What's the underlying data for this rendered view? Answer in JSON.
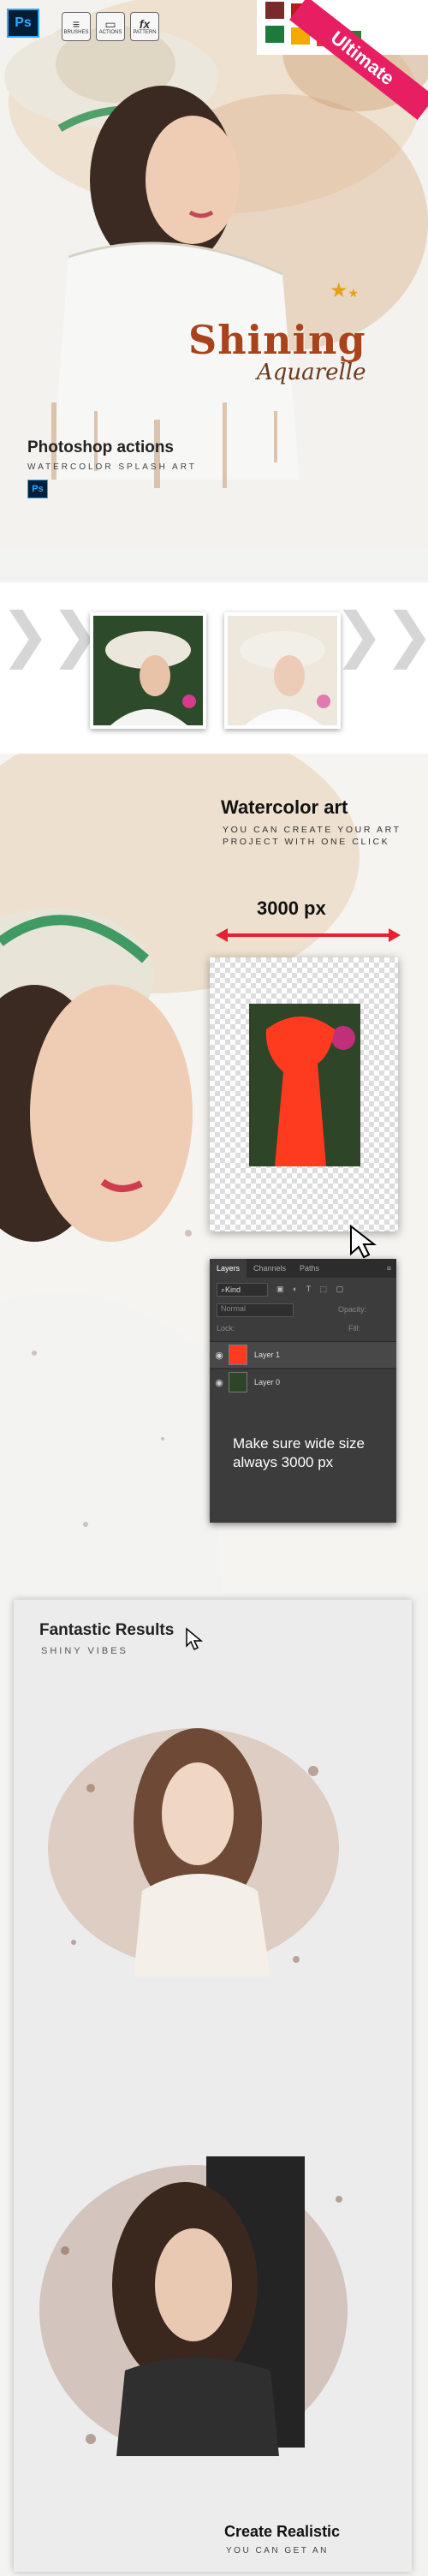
{
  "header": {
    "ps_badge": "Ps",
    "tools": [
      {
        "label": "BRUSHES",
        "glyph": "≡"
      },
      {
        "label": "ACTIONS",
        "glyph": "▭"
      },
      {
        "label": "PATTERN",
        "glyph": "fx"
      }
    ],
    "ribbon": "Ultimate"
  },
  "hero": {
    "title": "Shining",
    "subtitle": "Aquarelle",
    "heading": "Photoshop actions",
    "tagline": "WATERCOLOR SPLASH ART",
    "ps_small": "Ps"
  },
  "watercolor": {
    "title": "Watercolor art",
    "text": "YOU CAN CREATE YOUR ART PROJECT WITH ONE CLICK",
    "size_label": "3000 px"
  },
  "layers_panel": {
    "tabs": [
      "Layers",
      "Channels",
      "Paths"
    ],
    "kind": "Kind",
    "blend": "Normal",
    "opacity_label": "Opacity:",
    "lock_label": "Lock:",
    "fill_label": "Fill:",
    "layers": [
      "Layer 1",
      "Layer 0"
    ]
  },
  "note": "Make sure wide size always 3000 px",
  "results": {
    "title": "Fantastic Results",
    "subtitle": "SHINY VIBES"
  },
  "footer": {
    "title": "Create Realistic",
    "subtitle": "YOU CAN GET AN"
  },
  "colors": {
    "accent_red": "#e8202f",
    "ribbon_pink": "#e81e63",
    "title_brown": "#a8431c",
    "ps_blue": "#31a8ff"
  }
}
